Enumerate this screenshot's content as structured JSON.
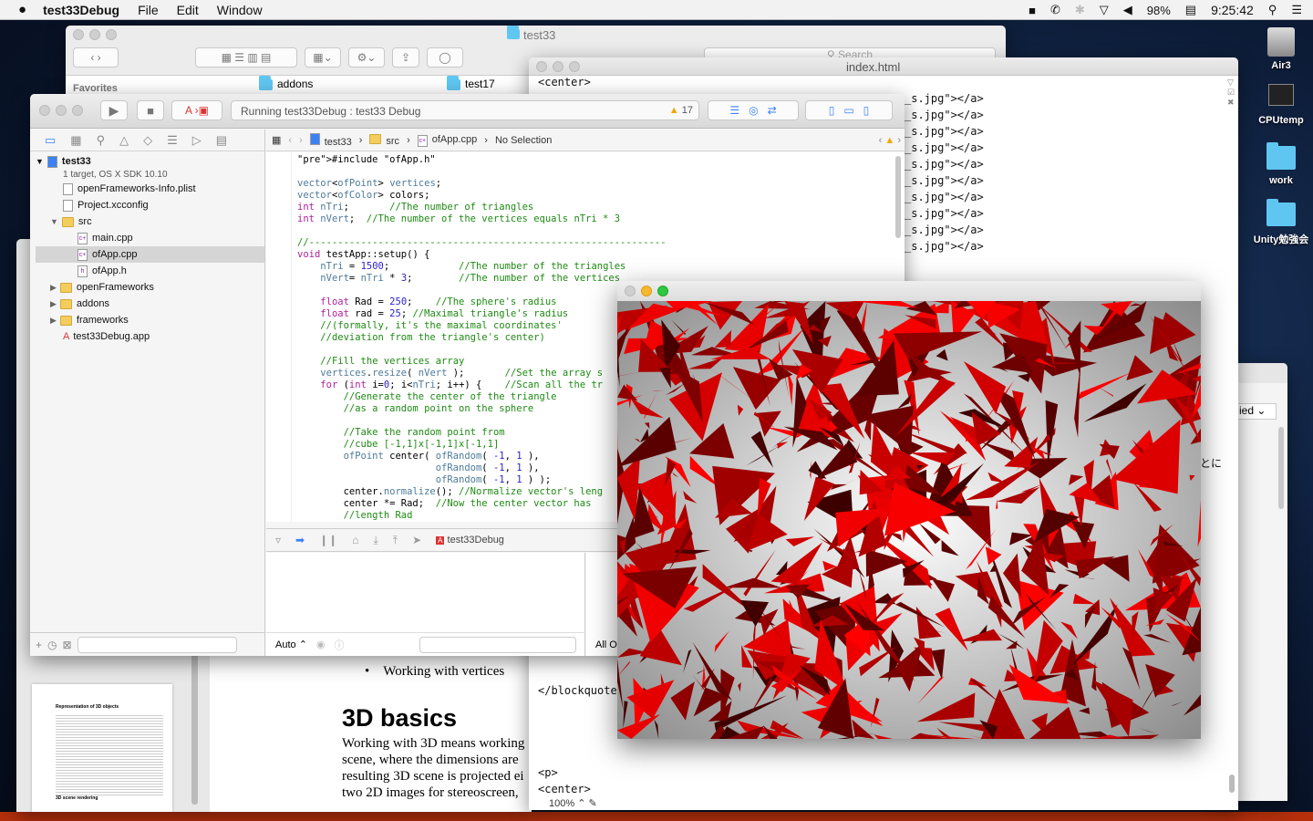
{
  "menubar": {
    "app": "test33Debug",
    "menus": [
      "File",
      "Edit",
      "Window"
    ],
    "battery": "98%",
    "clock": "9:25:42"
  },
  "desktop_icons": [
    {
      "label": "Air3"
    },
    {
      "label": "CPUtemp"
    },
    {
      "label": "work"
    },
    {
      "label": "Unity勉強会"
    }
  ],
  "finder": {
    "title": "test33",
    "sidebar_header": "Favorites",
    "col1_item": "addons",
    "col2_item": "test17",
    "search_placeholder": "Search"
  },
  "browser": {
    "title": "index.html",
    "lines": [
      "<center>",
      "_s.jpg\"></a>",
      "_s.jpg\"></a>",
      "_s.jpg\"></a>",
      "_s.jpg\"></a>",
      "_s.jpg\"></a>",
      "_s.jpg\"></a>",
      "_s.jpg\"></a>",
      "_s.jpg\"></a>",
      "_s.jpg\"></a>",
      "_s.jpg\"></a>"
    ],
    "blockquote": "</blockquote",
    "p": "<p>",
    "center": "<center>",
    "zoom": "100%",
    "side_text": "とに"
  },
  "right_window": {
    "dropdown": "ied"
  },
  "document": {
    "bullet": "Working with vertices",
    "heading": "3D basics",
    "para": [
      "Working with 3D means working",
      "scene, where the dimensions are",
      "resulting 3D scene is projected ei",
      "two 2D images for stereoscreen,"
    ],
    "thumb_title": "Representation of 3D objects",
    "thumb_sub": "3D scene rendering"
  },
  "xcode": {
    "status": "Running test33Debug : test33 Debug",
    "warnings": "17",
    "breadcrumb": [
      "test33",
      "src",
      "ofApp.cpp",
      "No Selection"
    ],
    "project": {
      "name": "test33",
      "subtitle": "1 target, OS X SDK 10.10"
    },
    "files": [
      {
        "name": "openFrameworks-Info.plist",
        "indent": 1,
        "kind": "doc"
      },
      {
        "name": "Project.xcconfig",
        "indent": 1,
        "kind": "doc"
      },
      {
        "name": "src",
        "indent": 1,
        "kind": "folder",
        "open": true
      },
      {
        "name": "main.cpp",
        "indent": 2,
        "kind": "doc"
      },
      {
        "name": "ofApp.cpp",
        "indent": 2,
        "kind": "doc",
        "selected": true
      },
      {
        "name": "ofApp.h",
        "indent": 2,
        "kind": "doc"
      },
      {
        "name": "openFrameworks",
        "indent": 1,
        "kind": "folder"
      },
      {
        "name": "addons",
        "indent": 1,
        "kind": "folder"
      },
      {
        "name": "frameworks",
        "indent": 1,
        "kind": "folder"
      },
      {
        "name": "test33Debug.app",
        "indent": 1,
        "kind": "app"
      }
    ],
    "debug_target": "test33Debug",
    "console_mode": "Auto",
    "console_filter": "All O",
    "code": [
      "#include \"ofApp.h\"",
      "",
      "vector<ofPoint> vertices;",
      "vector<ofColor> colors;",
      "int nTri;       //The number of triangles",
      "int nVert;  //The number of the vertices equals nTri * 3",
      "",
      "//--------------------------------------------------------------",
      "void testApp::setup() {",
      "    nTri = 1500;            //The number of the triangles",
      "    nVert= nTri * 3;        //The number of the vertices",
      "",
      "    float Rad = 250;    //The sphere's radius",
      "    float rad = 25; //Maximal triangle's radius",
      "    //(formally, it's the maximal coordinates'",
      "    //deviation from the triangle's center)",
      "",
      "    //Fill the vertices array",
      "    vertices.resize( nVert );       //Set the array s",
      "    for (int i=0; i<nTri; i++) {    //Scan all the tr",
      "        //Generate the center of the triangle",
      "        //as a random point on the sphere",
      "",
      "        //Take the random point from",
      "        //cube [-1,1]x[-1,1]x[-1,1]",
      "        ofPoint center( ofRandom( -1, 1 ),",
      "                        ofRandom( -1, 1 ),",
      "                        ofRandom( -1, 1 ) );",
      "        center.normalize(); //Normalize vector's leng",
      "        center *= Rad;  //Now the center vector has",
      "        //length Rad"
    ]
  },
  "colors": {
    "accent": "#3b82f6",
    "triangle_red": "#e50000",
    "dark_red": "#5a0000",
    "bg_gray": "#bdbdbd"
  }
}
